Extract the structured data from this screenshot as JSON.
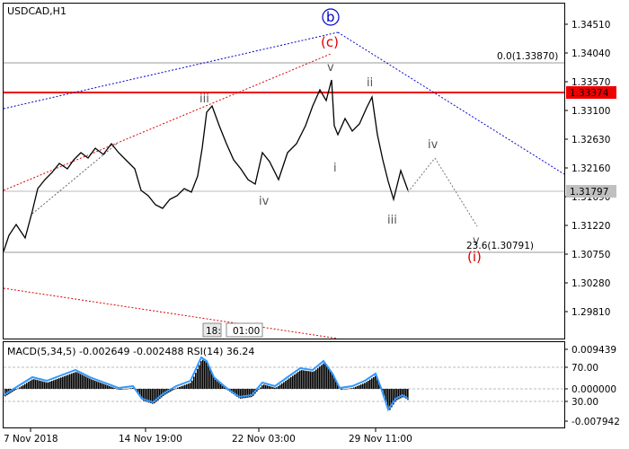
{
  "chart_title": "USDCAD,H1",
  "price_axis": [
    "1.34510",
    "1.34040",
    "1.33570",
    "1.33100",
    "1.32630",
    "1.32160",
    "1.31690",
    "1.31220",
    "1.30750",
    "1.30280",
    "1.29810"
  ],
  "tags": {
    "resistance": {
      "text": "1.33374",
      "color": "#ee0000"
    },
    "current": {
      "text": "1.31797",
      "color": "#c0c0c0"
    }
  },
  "fib": {
    "top": "0.0(1.33870)",
    "bottom": "23.6(1.30791)"
  },
  "waves": {
    "b": "b",
    "c": "(c)",
    "i_paren": "(i)",
    "v_top": "v",
    "iii_left": "iii",
    "iv_left": "iv",
    "i_mid": "i",
    "ii": "ii",
    "iii_low": "iii",
    "iv_proj": "iv",
    "v_proj": "v"
  },
  "scroll": {
    "left": "18:",
    "right": "01:00"
  },
  "indicator": {
    "label": "MACD(5,34,5) -0.002649 -0.002488 RSI(14) 36.24",
    "axis": [
      "0.009439",
      "70.00",
      "0.000000",
      "30.00",
      "-0.007942"
    ]
  },
  "time_axis": [
    "7 Nov 2018",
    "14 Nov 19:00",
    "22 Nov 03:00",
    "29 Nov 11:00"
  ],
  "colors": {
    "bullish_wave": "#0000cc",
    "correction": "#dd0000",
    "macd_line": "#3399ff"
  },
  "chart_data": {
    "type": "line",
    "symbol": "USDCAD",
    "timeframe": "H1",
    "x": [
      "7 Nov 2018",
      "14 Nov 19:00",
      "22 Nov 03:00",
      "29 Nov 11:00"
    ],
    "series": [],
    "ylim": [
      1.2981,
      1.3451
    ],
    "levels": [
      1.3387,
      1.33374,
      1.31797,
      1.30791
    ]
  }
}
